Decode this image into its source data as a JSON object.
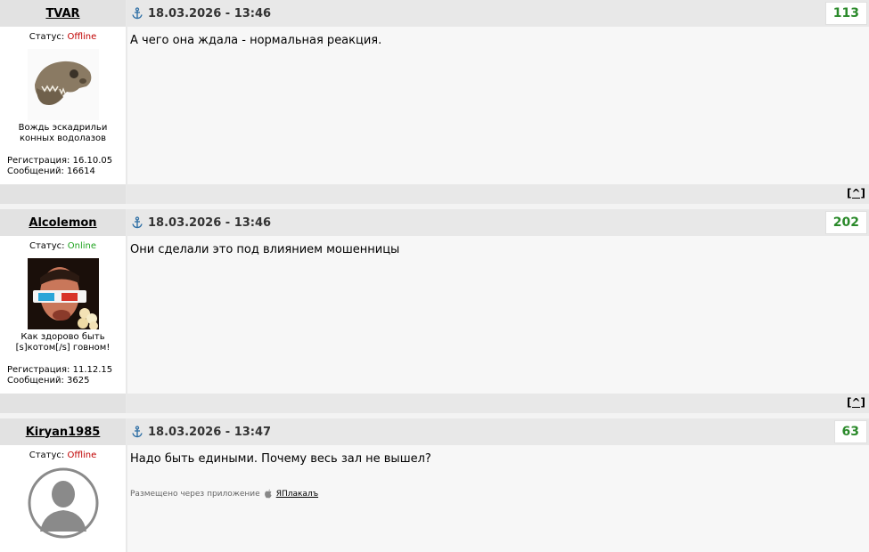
{
  "posts": [
    {
      "username": "TVAR",
      "date": "18.03.2026 - 13:46",
      "rating": "113",
      "status_label": "Статус:",
      "status_value": "Offline",
      "status_color": "#c00000",
      "avatar": "dinosaur-skull-avatar",
      "user_title_1": "Вождь эскадрильи",
      "user_title_2": "конных водолазов",
      "reg": "Регистрация: 16.10.05",
      "msgs": "Сообщений: 16614",
      "text": "А чего она ждала - нормальная реакция.",
      "up": "[^]"
    },
    {
      "username": "Alcolemon",
      "date": "18.03.2026 - 13:46",
      "rating": "202",
      "status_label": "Статус:",
      "status_value": "Online",
      "status_color": "#1fa31f",
      "avatar": "3d-glasses-popcorn-avatar",
      "user_title_1": "Как здорово быть",
      "user_title_2": "[s]котом[/s] говном!",
      "reg": "Регистрация: 11.12.15",
      "msgs": "Сообщений: 3625",
      "text": "Они сделали это под влиянием мошенницы",
      "up": "[^]"
    },
    {
      "username": "Kiryan1985",
      "date": "18.03.2026 - 13:47",
      "rating": "63",
      "status_label": "Статус:",
      "status_value": "Offline",
      "status_color": "#c00000",
      "avatar": "default-user-avatar",
      "text": "Надо быть едиными. Почему весь зал не вышел?",
      "via_label": "Размещено через приложение",
      "via_app": "ЯПлакалъ"
    }
  ],
  "icons": {
    "anchor": "anchor-icon",
    "apple": "apple-icon"
  }
}
